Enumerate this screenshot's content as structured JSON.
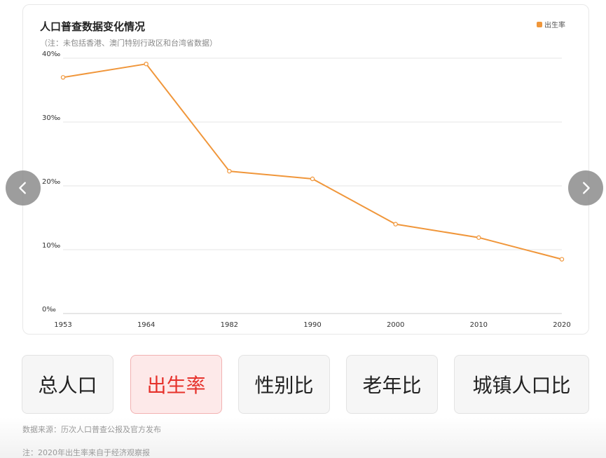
{
  "chart_data": {
    "type": "line",
    "title": "人口普查数据变化情况",
    "subtitle": "（注：未包括香港、澳门特别行政区和台湾省数据）",
    "categories": [
      "1953",
      "1964",
      "1982",
      "1990",
      "2000",
      "2010",
      "2020"
    ],
    "series": [
      {
        "name": "出生率",
        "values": [
          37.0,
          39.1,
          22.3,
          21.1,
          14.0,
          11.9,
          8.5
        ],
        "color": "#f0963a"
      }
    ],
    "yticks": [
      "0‰",
      "10‰",
      "20‰",
      "30‰",
      "40‰"
    ],
    "ylim": [
      0,
      40
    ],
    "grid": true,
    "legend_position": "top-right"
  },
  "tabs": [
    {
      "label": "总人口",
      "active": false
    },
    {
      "label": "出生率",
      "active": true
    },
    {
      "label": "性别比",
      "active": false
    },
    {
      "label": "老年比",
      "active": false
    },
    {
      "label": "城镇人口比",
      "active": false
    }
  ],
  "notes": {
    "source": "数据来源：历次人口普查公报及官方发布",
    "note": "注：2020年出生率来自于经济观察报"
  },
  "colors": {
    "accent": "#f0963a",
    "active_tab_text": "#e6322c"
  },
  "icons": {
    "prev": "chevron-left-icon",
    "next": "chevron-right-icon"
  }
}
